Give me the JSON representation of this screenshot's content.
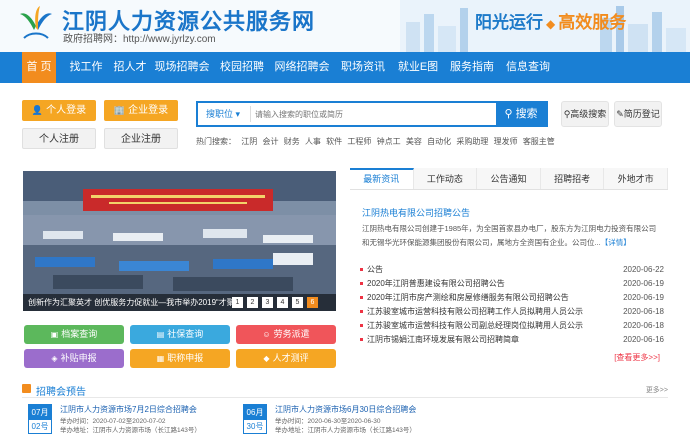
{
  "header": {
    "site_title": "江阴人力资源公共服务网",
    "site_subtitle": "政府招聘网：http://www.jyrlzy.com",
    "slogan_part1": "阳光运行",
    "slogan_part2": "高效服务",
    "slogan_sep": "◆"
  },
  "nav": {
    "items": [
      "首 页",
      "找工作",
      "招人才",
      "现场招聘会",
      "校园招聘",
      "网络招聘会",
      "职场资讯",
      "就业E图",
      "服务指南",
      "信息查询"
    ]
  },
  "login": {
    "personal_login": "个人登录",
    "company_login": "企业登录",
    "personal_register": "个人注册",
    "company_register": "企业注册"
  },
  "search": {
    "category": "搜职位",
    "placeholder": "请输入搜索的职位或简历",
    "button": "搜索",
    "advanced": "高级搜索",
    "resume_login": "简历登记",
    "hot_label": "热门搜索：",
    "hot_words": [
      "江阴",
      "会计",
      "财务",
      "人事",
      "软件",
      "工程师",
      "钟点工",
      "美容",
      "自动化",
      "采购助理",
      "理发师",
      "客服主管"
    ]
  },
  "banner": {
    "caption": "创新作为汇聚英才 创优服务力促就业—我市举办2019“才聚...",
    "pages": [
      "1",
      "2",
      "3",
      "4",
      "5",
      "6"
    ],
    "active_page": "6"
  },
  "quick_links": [
    {
      "label": "档案查询",
      "icon": "folder-icon",
      "color": "#5cb85c"
    },
    {
      "label": "社保查询",
      "icon": "card-icon",
      "color": "#3aa9de"
    },
    {
      "label": "劳务派遣",
      "icon": "people-icon",
      "color": "#f0555a"
    },
    {
      "label": "补贴申报",
      "icon": "stack-icon",
      "color": "#9b6dcc"
    },
    {
      "label": "职称申报",
      "icon": "badge-icon",
      "color": "#f5a623"
    },
    {
      "label": "人才测评",
      "icon": "cap-icon",
      "color": "#f5a623"
    }
  ],
  "news": {
    "tabs": [
      "最新资讯",
      "工作动态",
      "公告通知",
      "招聘招考",
      "外地才市"
    ],
    "active_tab": "最新资讯",
    "headline": "江阴热电有限公司招聘公告",
    "summary": "江阴热电有限公司创建于1985年，为全国首家县办电厂，股东方为江阴电力投资有限公司和无锡华光环保能源集团股份有限公司，属地方全资国有企业。公司位...",
    "summary_more": "【详情】",
    "items": [
      {
        "title": "公告",
        "date": "2020-06-22"
      },
      {
        "title": "2020年江阴普惠建设有限公司招聘公告",
        "date": "2020-06-19"
      },
      {
        "title": "2020年江阴市房产测绘和房屋修缮服务有限公司招聘公告",
        "date": "2020-06-19"
      },
      {
        "title": "江苏骏室城市运营科技有限公司招聘工作人员拟聘用人员公示",
        "date": "2020-06-18"
      },
      {
        "title": "江苏骏室城市运营科技有限公司副总经理岗位拟聘用人员公示",
        "date": "2020-06-18"
      },
      {
        "title": "江阴市锡娟江南环境发展有限公司招聘简章",
        "date": "2020-06-16"
      }
    ],
    "more": "[查看更多>>]"
  },
  "fairs": {
    "title": "招聘会预告",
    "more": "更多>>",
    "items": [
      {
        "month": "07月",
        "day": "02号",
        "title": "江阴市人力资源市场7月2日综合招聘会",
        "time": "举办时间：2020-07-02至2020-07-02",
        "addr": "举办地址：江阴市人力资源市场（长江路143号）"
      },
      {
        "month": "06月",
        "day": "30号",
        "title": "江阴市人力资源市场6月30日综合招聘会",
        "time": "举办时间：2020-06-30至2020-06-30",
        "addr": "举办地址：江阴市人力资源市场（长江路143号）"
      }
    ]
  }
}
